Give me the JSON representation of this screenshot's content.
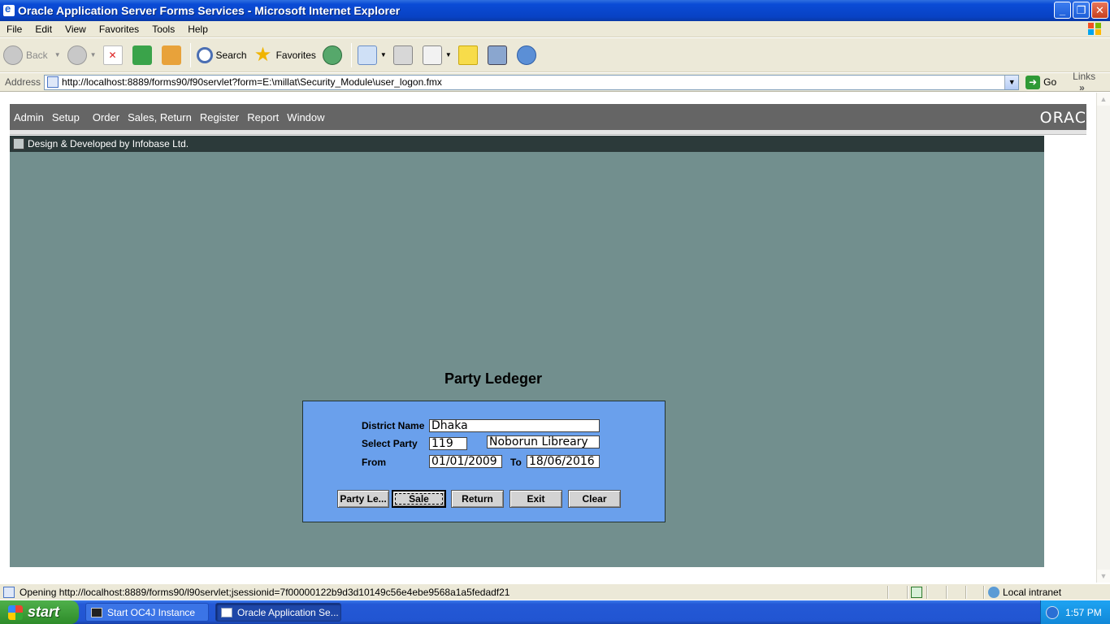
{
  "window": {
    "title": "Oracle Application Server Forms Services - Microsoft Internet Explorer"
  },
  "ie_menu": [
    "File",
    "Edit",
    "View",
    "Favorites",
    "Tools",
    "Help"
  ],
  "toolbar": {
    "back": "Back",
    "search": "Search",
    "favorites": "Favorites"
  },
  "address": {
    "label": "Address",
    "url": "http://localhost:8889/forms90/f90servlet?form=E:\\millat\\Security_Module\\user_logon.fmx",
    "go": "Go",
    "links": "Links"
  },
  "forms_menu": {
    "items": [
      "Admin",
      "Setup",
      "Order",
      "Sales, Return",
      "Register",
      "Report",
      "Window"
    ],
    "logo": "ORAC"
  },
  "mdi": {
    "title": "Design & Developed by Infobase Ltd."
  },
  "form": {
    "heading": "Party Ledeger",
    "district_label": "District Name",
    "district_value": "Dhaka",
    "party_label": "Select Party",
    "party_code": "119",
    "party_name": "Noborun Libreary",
    "from_label": "From",
    "from_value": "01/01/2009",
    "to_label": "To",
    "to_value": "18/06/2016",
    "buttons": {
      "party_ledger": "Party Le...",
      "sale": "Sale",
      "return": "Return",
      "exit": "Exit",
      "clear": "Clear"
    }
  },
  "status": {
    "text": "Opening http://localhost:8889/forms90/l90servlet;jsessionid=7f00000122b9d3d10149c56e4ebe9568a1a5fedadf21",
    "zone": "Local intranet"
  },
  "taskbar": {
    "start": "start",
    "tasks": [
      "Start OC4J Instance",
      "Oracle Application Se..."
    ],
    "clock": "1:57 PM"
  },
  "colors": {
    "mdi_background": "#728f8e",
    "panel_background": "#6aa0ec",
    "forms_menu": "#656565"
  }
}
